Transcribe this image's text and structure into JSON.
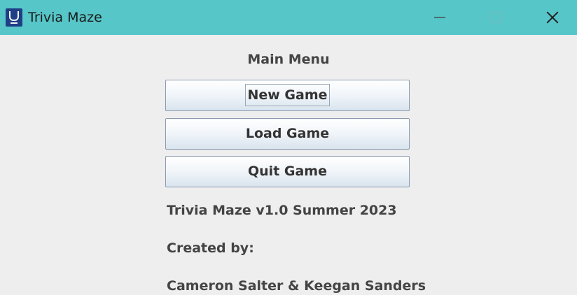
{
  "window": {
    "title": "Trivia Maze",
    "title_bar_color": "#56c6c8",
    "icon": "app-icon"
  },
  "controls": {
    "minimize_icon": "minimize-icon",
    "maximize_icon": "maximize-icon",
    "close_icon": "close-icon"
  },
  "menu": {
    "title": "Main Menu",
    "buttons": [
      {
        "label": "New Game",
        "focused": true
      },
      {
        "label": "Load Game",
        "focused": false
      },
      {
        "label": "Quit Game",
        "focused": false
      }
    ]
  },
  "info": {
    "version": "Trivia Maze v1.0 Summer 2023",
    "created_label": "Created by:",
    "authors": "Cameron Salter & Keegan Sanders"
  }
}
